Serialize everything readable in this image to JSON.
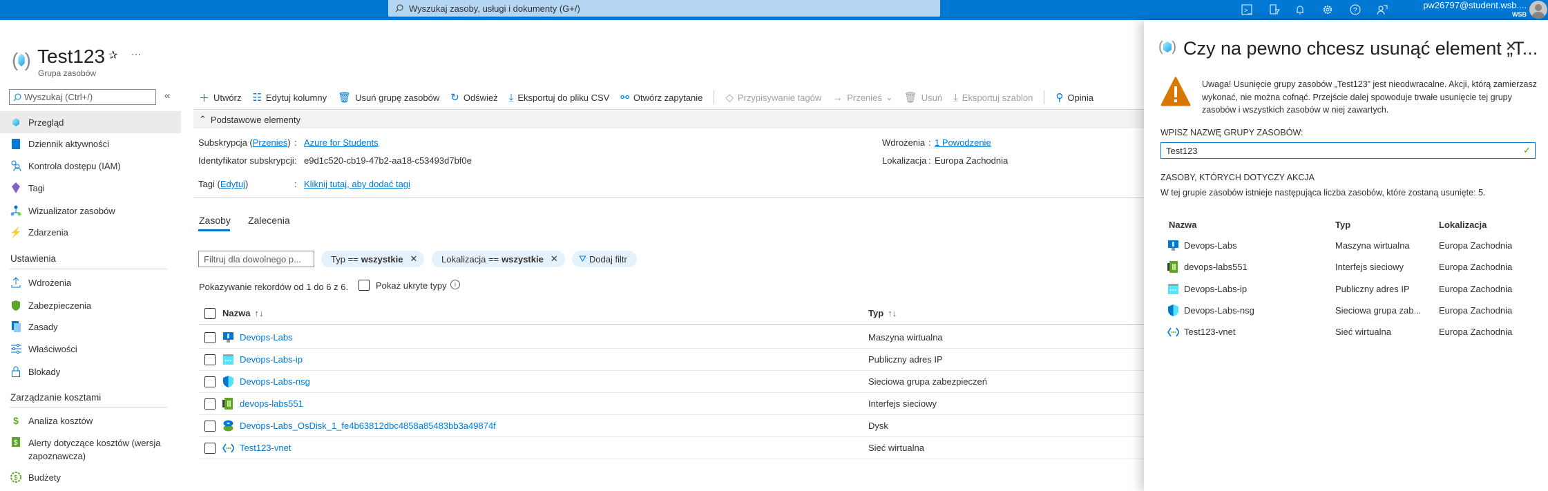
{
  "topbar": {
    "search_placeholder": "Wyszukaj zasoby, usługi i dokumenty (G+/)",
    "icons": [
      "cloud-shell-icon",
      "directory-filter-icon",
      "bell-icon",
      "gear-icon",
      "help-icon",
      "feedback-icon"
    ],
    "user_email": "pw26797@student.wsb....",
    "user_org": "WSB",
    "color": "#0078d4"
  },
  "header": {
    "title": "Test123",
    "subtitle": "Grupa zasobów",
    "more": "···"
  },
  "sidebar": {
    "search_placeholder": "Wyszukaj (Ctrl+/)",
    "collapse": "«",
    "items": [
      {
        "label": "Przegląd",
        "icon": "resource-group-icon",
        "selected": true
      },
      {
        "label": "Dziennik aktywności",
        "icon": "activity-log-icon"
      },
      {
        "label": "Kontrola dostępu (IAM)",
        "icon": "iam-icon"
      },
      {
        "label": "Tagi",
        "icon": "tag-icon"
      },
      {
        "label": "Wizualizator zasobów",
        "icon": "visualizer-icon"
      },
      {
        "label": "Zdarzenia",
        "icon": "lightning-icon"
      }
    ],
    "section_settings": "Ustawienia",
    "settings": [
      {
        "label": "Wdrożenia",
        "icon": "upload-icon"
      },
      {
        "label": "Zabezpieczenia",
        "icon": "shield-icon"
      },
      {
        "label": "Zasady",
        "icon": "policy-icon"
      },
      {
        "label": "Właściwości",
        "icon": "properties-icon"
      },
      {
        "label": "Blokady",
        "icon": "lock-icon"
      }
    ],
    "section_cost": "Zarządzanie kosztami",
    "cost": [
      {
        "label": "Analiza kosztów",
        "icon": "cost-analysis-icon"
      },
      {
        "label": "Alerty dotyczące kosztów (wersja zapoznawcza)",
        "icon": "cost-alert-icon"
      },
      {
        "label": "Budżety",
        "icon": "budget-icon"
      }
    ]
  },
  "toolbar": {
    "create": "Utwórz",
    "edit_columns": "Edytuj kolumny",
    "delete_group": "Usuń grupę zasobów",
    "refresh": "Odśwież",
    "export_csv": "Eksportuj do pliku CSV",
    "open_query": "Otwórz zapytanie",
    "assign_tags": "Przypisywanie tagów",
    "move": "Przenieś",
    "delete": "Usuń",
    "export_template": "Eksportuj szablon",
    "feedback": "Opinia"
  },
  "essentials": {
    "header": "Podstawowe elementy",
    "subscription_label": "Subskrypcja",
    "subscription_move": "Przenieś",
    "subscription_value": "Azure for Students",
    "subscription_id_label": "Identyfikator subskrypcji",
    "subscription_id_value": "e9d1c520-cb19-47b2-aa18-c53493d7bf0e",
    "tags_label": "Tagi",
    "tags_edit": "Edytuj",
    "tags_value": "Kliknij tutaj, aby dodać tagi",
    "deployments_label": "Wdrożenia",
    "deployments_value": "1 Powodzenie",
    "location_label": "Lokalizacja",
    "location_value": "Europa Zachodnia"
  },
  "tabs": [
    {
      "label": "Zasoby",
      "active": true
    },
    {
      "label": "Zalecenia"
    }
  ],
  "filters": {
    "placeholder": "Filtruj dla dowolnego p...",
    "type_pill": "Typ ==",
    "type_value": "wszystkie",
    "loc_pill": "Lokalizacja ==",
    "loc_value": "wszystkie",
    "add_filter": "Dodaj filtr"
  },
  "records": {
    "text": "Pokazywanie rekordów od 1 do 6 z 6.",
    "show_hidden": "Pokaż ukryte typy",
    "show_hidden_checked": false
  },
  "table": {
    "col_name": "Nazwa",
    "col_type": "Typ",
    "rows": [
      {
        "name": "Devops-Labs",
        "type": "Maszyna wirtualna",
        "icon": "vm-icon"
      },
      {
        "name": "Devops-Labs-ip",
        "type": "Publiczny adres IP",
        "icon": "public-ip-icon"
      },
      {
        "name": "Devops-Labs-nsg",
        "type": "Sieciowa grupa zabezpieczeń",
        "icon": "nsg-icon"
      },
      {
        "name": "devops-labs551",
        "type": "Interfejs sieciowy",
        "icon": "nic-icon"
      },
      {
        "name": "Devops-Labs_OsDisk_1_fe4b63812dbc4858a85483bb3a49874f",
        "type": "Dysk",
        "icon": "disk-icon"
      },
      {
        "name": "Test123-vnet",
        "type": "Sieć wirtualna",
        "icon": "vnet-icon"
      }
    ]
  },
  "panel": {
    "title": "Czy na pewno chcesz usunąć element „T...",
    "warning": "Uwaga! Usunięcie grupy zasobów „Test123” jest nieodwracalne. Akcji, którą zamierzasz wykonać, nie można cofnąć. Przejście dalej spowoduje trwałe usunięcie tej grupy zasobów i wszystkich zasobów w niej zawartych.",
    "warning_color": "#d97800",
    "input_label": "WPISZ NAZWĘ GRUPY ZASOBÓW:",
    "input_value": "Test123",
    "affected_header": "ZASOBY, KTÓRYCH DOTYCZY AKCJA",
    "affected_text": "W tej grupie zasobów istnieje następująca liczba zasobów, które zostaną usunięte: 5.",
    "col_name": "Nazwa",
    "col_type": "Typ",
    "col_loc": "Lokalizacja",
    "rows": [
      {
        "name": "Devops-Labs",
        "type": "Maszyna wirtualna",
        "loc": "Europa Zachodnia",
        "icon": "vm-icon"
      },
      {
        "name": "devops-labs551",
        "type": "Interfejs sieciowy",
        "loc": "Europa Zachodnia",
        "icon": "nic-icon"
      },
      {
        "name": "Devops-Labs-ip",
        "type": "Publiczny adres IP",
        "loc": "Europa Zachodnia",
        "icon": "public-ip-icon"
      },
      {
        "name": "Devops-Labs-nsg",
        "type": "Sieciowa grupa zab...",
        "loc": "Europa Zachodnia",
        "icon": "nsg-icon"
      },
      {
        "name": "Test123-vnet",
        "type": "Sieć wirtualna",
        "loc": "Europa Zachodnia",
        "icon": "vnet-icon"
      }
    ]
  }
}
